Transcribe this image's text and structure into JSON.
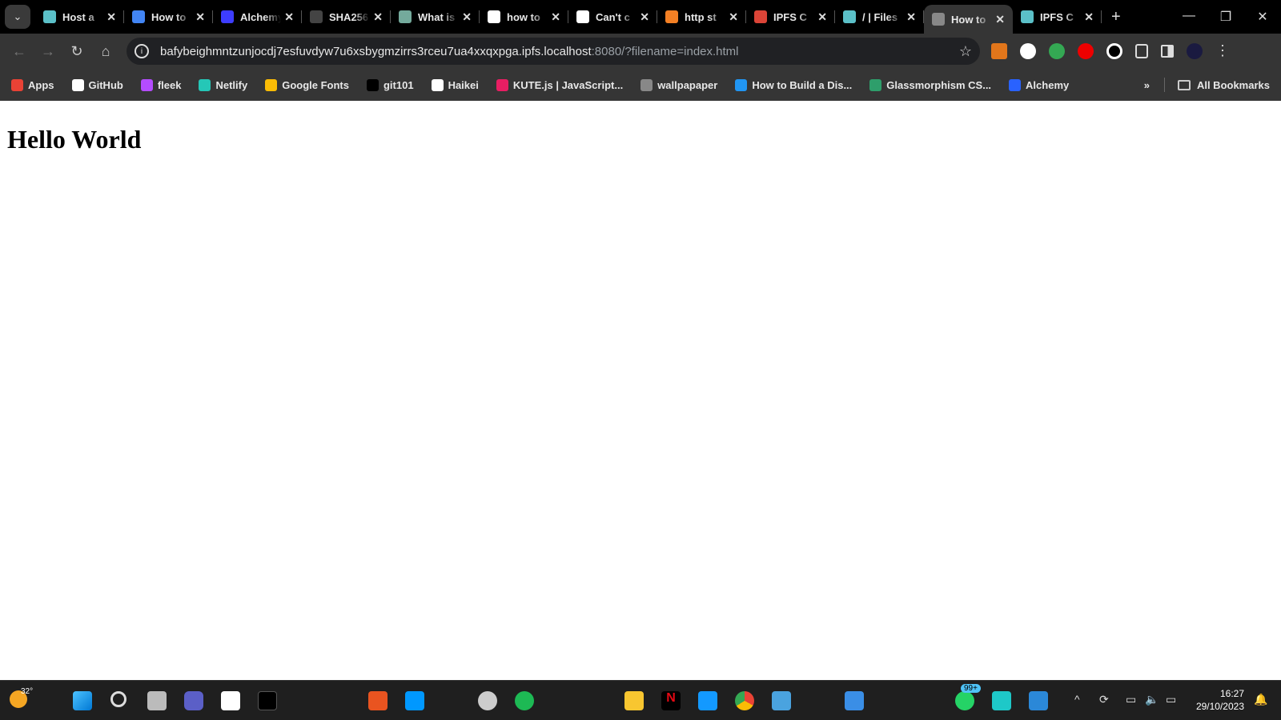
{
  "tabs": [
    {
      "title": "Host a",
      "color": "#5bc0c8"
    },
    {
      "title": "How to",
      "color": "#4285f4"
    },
    {
      "title": "Alchemy",
      "color": "#3d3dff"
    },
    {
      "title": "SHA256",
      "color": "#444"
    },
    {
      "title": "What is",
      "color": "#74aa9c"
    },
    {
      "title": "how to",
      "color": "#fff"
    },
    {
      "title": "Can't c",
      "color": "#fff"
    },
    {
      "title": "http st",
      "color": "#f48024"
    },
    {
      "title": "IPFS C",
      "color": "#db4437"
    },
    {
      "title": "/ | Files",
      "color": "#5bc0c8"
    },
    {
      "title": "How to",
      "color": "#888",
      "active": true
    },
    {
      "title": "IPFS C",
      "color": "#5bc0c8"
    }
  ],
  "address": {
    "host": "bafybeighmntzunjocdj7esfuvdyw7u6xsbygmzirrs3rceu7ua4xxqxpga.ipfs.localhost",
    "rest": ":8080/?filename=index.html"
  },
  "bookmarks": [
    {
      "label": "Apps",
      "color": "#e94235"
    },
    {
      "label": "GitHub",
      "color": "#fff"
    },
    {
      "label": "fleek",
      "color": "#b44cff"
    },
    {
      "label": "Netlify",
      "color": "#25c7b7"
    },
    {
      "label": "Google Fonts",
      "color": "#fbbc05"
    },
    {
      "label": "git101",
      "color": "#000"
    },
    {
      "label": "Haikei",
      "color": "#fff"
    },
    {
      "label": "KUTE.js | JavaScript...",
      "color": "#e91e63"
    },
    {
      "label": "wallpapaper",
      "color": "#888"
    },
    {
      "label": "How to Build a Dis...",
      "color": "#2196f3"
    },
    {
      "label": "Glassmorphism CS...",
      "color": "#2e9e6b"
    },
    {
      "label": "Alchemy",
      "color": "#2962ff"
    }
  ],
  "all_bookmarks": "All Bookmarks",
  "page": {
    "heading": "Hello World"
  },
  "taskbar": {
    "weather": "32°",
    "badge": "99+",
    "time": "16:27",
    "date": "29/10/2023"
  }
}
